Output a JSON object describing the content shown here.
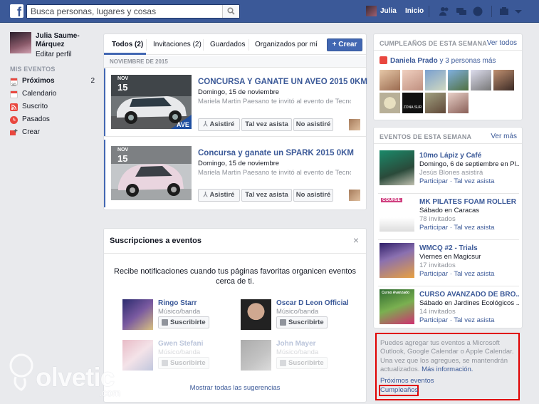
{
  "topbar": {
    "logo": "f",
    "search_placeholder": "Busca personas, lugares y cosas",
    "user_name": "Julia",
    "home_label": "Inicio",
    "icons": [
      "friends-icon",
      "messages-icon",
      "notifications-icon",
      "settings-icon",
      "chevron-down-icon"
    ]
  },
  "sidebar": {
    "profile_name": "Julia Saume-Márquez",
    "edit_profile": "Editar perfil",
    "section_title": "MIS EVENTOS",
    "items": [
      {
        "label": "Próximos",
        "count": "2",
        "icon": "calendar-icon",
        "color": "#e9473f"
      },
      {
        "label": "Calendario",
        "count": "",
        "icon": "calendar-icon",
        "color": "#e9473f"
      },
      {
        "label": "Suscrito",
        "count": "",
        "icon": "rss-icon",
        "color": "#e9473f"
      },
      {
        "label": "Pasados",
        "count": "",
        "icon": "clock-icon",
        "color": "#e9473f"
      },
      {
        "label": "Crear",
        "count": "",
        "icon": "plus-icon",
        "color": "#e9473f"
      }
    ]
  },
  "events": {
    "tabs": [
      {
        "label": "Todos (2)",
        "active": true
      },
      {
        "label": "Invitaciones (2)",
        "active": false
      },
      {
        "label": "Guardados",
        "active": false
      },
      {
        "label": "Organizados por mí",
        "active": false
      }
    ],
    "create_label": "+ Crear",
    "month_label": "NOVIEMBRE DE 2015",
    "items": [
      {
        "month": "NOV",
        "day": "15",
        "title": "CONCURSA Y GANATE UN AVEO 2015 0KM",
        "date": "Domingo, 15 de noviembre",
        "invite": "Mariela Martin Paesano te invitó al evento de Tecno...",
        "btn_going": "Asistiré",
        "btn_maybe": "Tal vez asista",
        "btn_no": "No asistiré"
      },
      {
        "month": "NOV",
        "day": "15",
        "title": "Concursa y ganate un SPARK 2015 0KM",
        "date": "Domingo, 15 de noviembre",
        "invite": "Mariela Martin Paesano te invitó al evento de Tecno...",
        "btn_going": "Asistiré",
        "btn_maybe": "Tal vez asista",
        "btn_no": "No asistiré"
      }
    ]
  },
  "subscriptions": {
    "title": "Suscripciones a eventos",
    "close": "×",
    "description": "Recibe notificaciones cuando tus páginas favoritas organicen eventos cerca de ti.",
    "suggestions": [
      {
        "name": "Ringo Starr",
        "category": "Músico/banda",
        "button": "Suscribirte"
      },
      {
        "name": "Oscar D Leon Official",
        "category": "Músico/banda",
        "button": "Suscribirte"
      },
      {
        "name": "Gwen Stefani",
        "category": "Músico/banda",
        "button": "Suscribirte"
      },
      {
        "name": "John Mayer",
        "category": "Músico/banda",
        "button": "Suscribirte"
      }
    ],
    "show_all": "Mostrar todas las sugerencias"
  },
  "birthdays": {
    "title": "CUMPLEAÑOS DE ESTA SEMANA",
    "see_all": "Ver todos",
    "name": "Daniela Prado",
    "others": "y 3 personas más",
    "photo_captions": [
      "ZONA SUR"
    ]
  },
  "week_events": {
    "title": "EVENTOS DE ESTA SEMANA",
    "see_more": "Ver más",
    "items": [
      {
        "title": "10mo Lápiz y Café",
        "line1": "Domingo, 6 de septiembre en Pl...",
        "line2": "Jesús Blones asistirá",
        "action1": "Participar",
        "action2": "Tal vez asista"
      },
      {
        "title": "MK PILATES FOAM ROLLER",
        "line1": "Sábado en Caracas",
        "line2": "78 invitados",
        "action1": "Participar",
        "action2": "Tal vez asista",
        "thumb_label": "COURSE"
      },
      {
        "title": "WMCQ #2 - Trials",
        "line1": "Viernes en Magicsur",
        "line2": "17 invitados",
        "action1": "Participar",
        "action2": "Tal vez asista"
      },
      {
        "title": "CURSO AVANZADO DE BRO...",
        "line1": "Sábado en Jardines Ecológicos ...",
        "line2": "14 invitados",
        "action1": "Participar",
        "action2": "Tal vez asista",
        "thumb_label": "Curso Avanzado"
      }
    ]
  },
  "calendar_info": {
    "text": "Puedes agregar tus eventos a Microsoft Outlook, Google Calendar o Apple Calendar. Una vez que los agregues, se mantendrán actualizados.",
    "more_info": "Más información.",
    "upcoming": "Próximos eventos",
    "birthdays": "Cumpleaños",
    "highlight_color": "#e00000"
  },
  "watermark": {
    "text": "olvetic",
    "domain": ".com"
  },
  "colors": {
    "brand": "#3b5998",
    "button_primary": "#4267b2",
    "background": "#e9eaed"
  }
}
